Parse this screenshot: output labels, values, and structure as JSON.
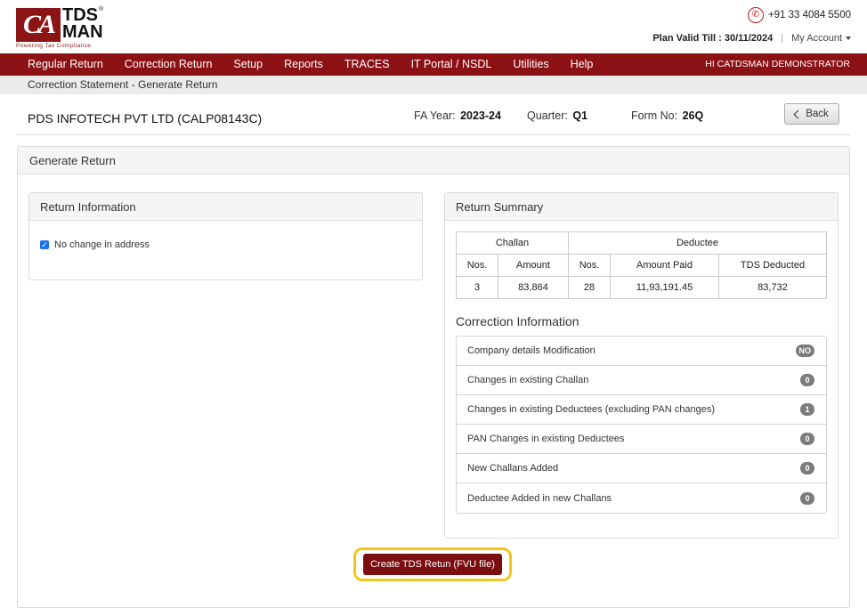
{
  "brand": {
    "logo_ca": "CA",
    "logo_tds": "TDS",
    "logo_man": "MAN",
    "logo_reg": "®",
    "tagline": "Powering Tax Compliance",
    "accent_color": "#8c1114"
  },
  "header": {
    "phone": "+91 33 4084 5500",
    "plan_valid": "Plan Valid Till : 30/11/2024",
    "separator": "|",
    "my_account": "My Account"
  },
  "nav": {
    "items": [
      {
        "label": "Regular Return"
      },
      {
        "label": "Correction Return"
      },
      {
        "label": "Setup"
      },
      {
        "label": "Reports"
      },
      {
        "label": "TRACES"
      },
      {
        "label": "IT Portal / NSDL"
      },
      {
        "label": "Utilities"
      },
      {
        "label": "Help"
      }
    ],
    "greeting": "Hi CATDSMAN DEMONSTRATOR"
  },
  "breadcrumb": "Correction Statement - Generate Return",
  "company": {
    "name": "PDS INFOTECH PVT LTD (CALP08143C)",
    "fa_label": "FA Year:",
    "fa_value": "2023-24",
    "quarter_label": "Quarter:",
    "quarter_value": "Q1",
    "form_label": "Form No:",
    "form_value": "26Q",
    "back_label": "Back"
  },
  "main": {
    "title": "Generate Return",
    "return_info": {
      "title": "Return Information",
      "checkbox_label": "No change in address",
      "checked": true
    },
    "return_summary": {
      "title": "Return Summary",
      "group_challan": "Challan",
      "group_deductee": "Deductee",
      "headers": [
        "Nos.",
        "Amount",
        "Nos.",
        "Amount Paid",
        "TDS Deducted"
      ],
      "row": [
        "3",
        "83,864",
        "28",
        "11,93,191.45",
        "83,732"
      ]
    },
    "correction": {
      "title": "Correction Information",
      "items": [
        {
          "label": "Company details Modification",
          "badge": "NO"
        },
        {
          "label": "Changes in existing Challan",
          "badge": "0"
        },
        {
          "label": "Changes in existing Deductees (excluding PAN changes)",
          "badge": "1"
        },
        {
          "label": "PAN Changes in existing Deductees",
          "badge": "0"
        },
        {
          "label": "New Challans Added",
          "badge": "0"
        },
        {
          "label": "Deductee Added in new Challans",
          "badge": "0"
        }
      ]
    },
    "cta_label": "Create TDS Retun (FVU file)"
  }
}
